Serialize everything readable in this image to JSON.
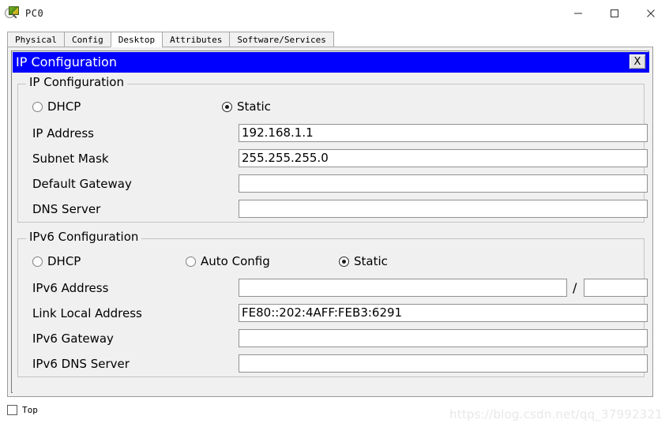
{
  "window": {
    "title": "PC0",
    "icon": "packet-tracer-pc-icon",
    "controls": {
      "minimize": "—",
      "maximize": "□",
      "close": "✕"
    }
  },
  "tabs": [
    {
      "label": "Physical",
      "selected": false
    },
    {
      "label": "Config",
      "selected": false
    },
    {
      "label": "Desktop",
      "selected": true
    },
    {
      "label": "Attributes",
      "selected": false
    },
    {
      "label": "Software/Services",
      "selected": false
    }
  ],
  "internal_frame": {
    "title": "IP Configuration",
    "close_label": "X",
    "title_bar_color": "#0000ff",
    "title_text_color": "#ffffff"
  },
  "ipv4_group": {
    "legend": "IP Configuration",
    "modes": [
      {
        "label": "DHCP",
        "selected": false
      },
      {
        "label": "Static",
        "selected": true
      }
    ],
    "fields": [
      {
        "label": "IP Address",
        "value": "192.168.1.1"
      },
      {
        "label": "Subnet Mask",
        "value": "255.255.255.0"
      },
      {
        "label": "Default Gateway",
        "value": ""
      },
      {
        "label": "DNS Server",
        "value": ""
      }
    ]
  },
  "ipv6_group": {
    "legend": "IPv6 Configuration",
    "modes": [
      {
        "label": "DHCP",
        "selected": false
      },
      {
        "label": "Auto Config",
        "selected": false
      },
      {
        "label": "Static",
        "selected": true
      }
    ],
    "address_row": {
      "label": "IPv6 Address",
      "value": "",
      "separator": "/",
      "prefix_value": ""
    },
    "fields": [
      {
        "label": "Link Local Address",
        "value": "FE80::202:4AFF:FEB3:6291"
      },
      {
        "label": "IPv6 Gateway",
        "value": ""
      },
      {
        "label": "IPv6 DNS Server",
        "value": ""
      }
    ]
  },
  "bottom": {
    "top_checkbox_label": "Top",
    "top_checkbox_checked": false,
    "watermark": "https://blog.csdn.net/qq_37992321"
  }
}
